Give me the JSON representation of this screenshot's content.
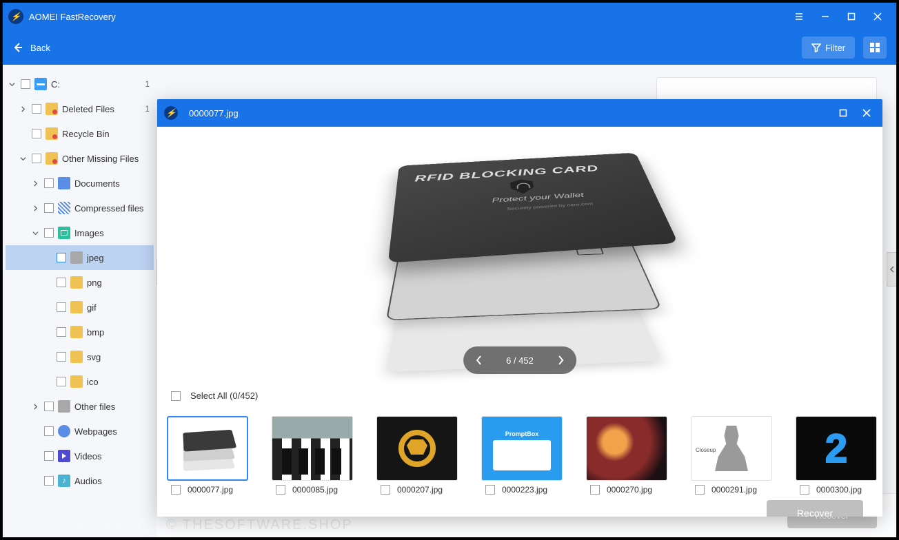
{
  "app": {
    "title": "AOMEI FastRecovery"
  },
  "toolbar": {
    "back": "Back",
    "filter": "Filter"
  },
  "tree": {
    "drive": "C:",
    "drive_count": "1",
    "deleted": "Deleted Files",
    "deleted_count": "1",
    "recycle": "Recycle Bin",
    "missing": "Other Missing Files",
    "documents": "Documents",
    "compressed": "Compressed files",
    "images": "Images",
    "jpeg": "jpeg",
    "png": "png",
    "gif": "gif",
    "bmp": "bmp",
    "svg": "svg",
    "ico": "ico",
    "other": "Other files",
    "webpages": "Webpages",
    "videos": "Videos",
    "audios": "Audios"
  },
  "main": {
    "recover": "Recover"
  },
  "modal": {
    "filename": "0000077.jpg",
    "pager": "6 / 452",
    "select_all": "Select  All (0/452)",
    "recover": "Recover",
    "thumbs": [
      {
        "name": "0000077.jpg"
      },
      {
        "name": "0000085.jpg"
      },
      {
        "name": "0000207.jpg"
      },
      {
        "name": "0000223.jpg"
      },
      {
        "name": "0000270.jpg"
      },
      {
        "name": "0000291.jpg"
      },
      {
        "name": "0000300.jpg"
      }
    ],
    "preview_card": {
      "line1": "RFID BLOCKING CARD",
      "line2": "Protect your Wallet",
      "line3": "Securely powered by nero.com"
    },
    "thumb4_headline": "PromptBox",
    "thumb6_tag": "Closeup"
  },
  "watermark": "© THESOFTWARE.SHOP"
}
